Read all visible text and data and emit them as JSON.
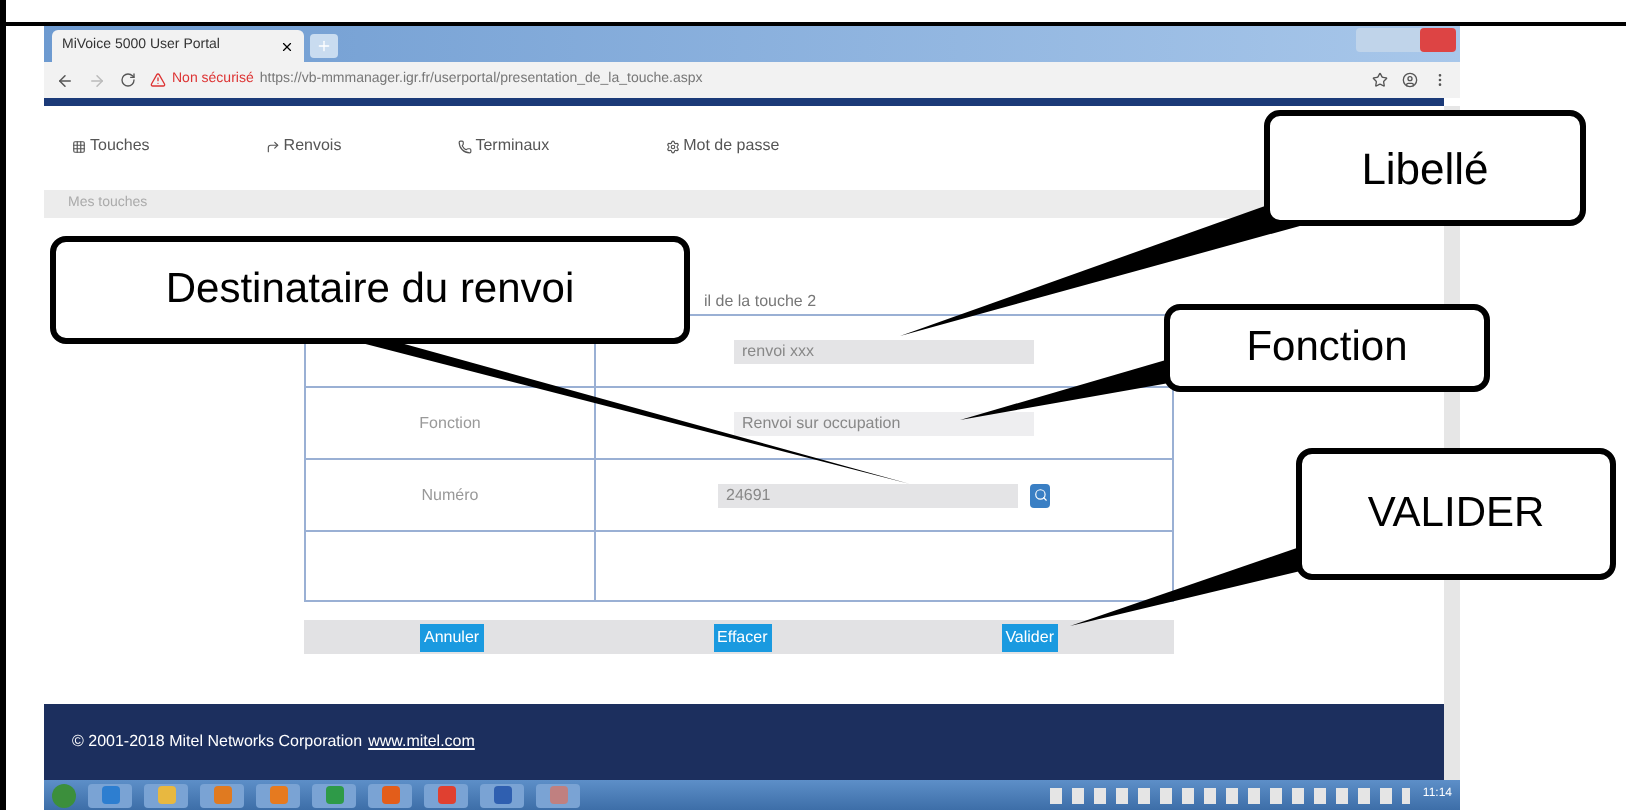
{
  "browser": {
    "tab_title": "MiVoice 5000 User Portal",
    "security": "Non sécurisé",
    "url": "https://vb-mmmanager.igr.fr/userportal/presentation_de_la_touche.aspx"
  },
  "nav": [
    {
      "label": "Touches"
    },
    {
      "label": "Renvois"
    },
    {
      "label": "Terminaux"
    },
    {
      "label": "Mot de passe"
    }
  ],
  "section_title": "Mes touches",
  "form": {
    "caption": "il de la touche 2",
    "rows": [
      {
        "kind": "text",
        "value": "renvoi xxx"
      },
      {
        "kind": "select",
        "label": "Fonction",
        "value": "Renvoi sur occupation"
      },
      {
        "kind": "lookup",
        "label": "Numéro",
        "value": "24691"
      },
      {
        "kind": "empty"
      }
    ]
  },
  "buttons": [
    "Annuler",
    "Effacer",
    "Valider"
  ],
  "footer": {
    "copyright": "© 2001-2018 Mitel Networks Corporation",
    "link": "www.mitel.com"
  },
  "taskbar": {
    "clock": "11:14"
  },
  "callouts": [
    {
      "text": "Libellé"
    },
    {
      "text": "Destinataire du renvoi"
    },
    {
      "text": "Fonction"
    },
    {
      "text": "VALIDER"
    }
  ]
}
